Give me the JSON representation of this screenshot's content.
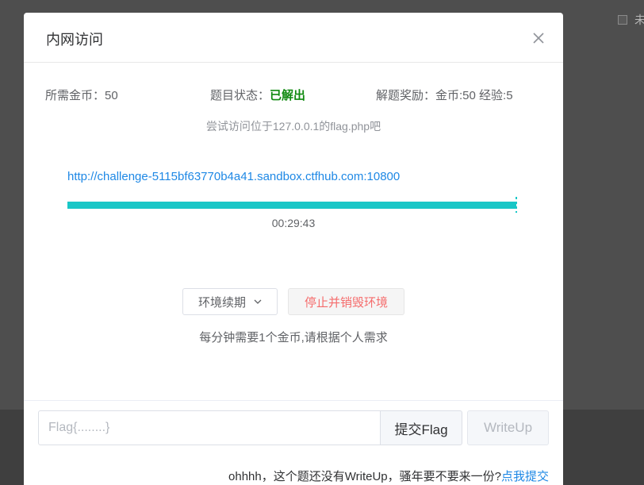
{
  "background": {
    "checkbox_text": "未"
  },
  "modal": {
    "title": "内网访问",
    "info": {
      "coins_label": "所需金币：",
      "coins_value": "50",
      "status_label": "题目状态：",
      "status_value": "已解出",
      "reward_label": "解题奖励：",
      "reward_value": "金币:50 经验:5"
    },
    "hint": "尝试访问位于127.0.0.1的flag.php吧",
    "url": "http://challenge-5115bf63770b4a41.sandbox.ctfhub.com:10800",
    "timer": "00:29:43",
    "progress_fraction": 1.0,
    "renew_label": "环境续期",
    "stop_label": "停止并销毁环境",
    "cost_note": "每分钟需要1个金币,请根据个人需求",
    "flag_placeholder": "Flag{........}",
    "submit_label": "提交Flag",
    "writeup_label": "WriteUp",
    "writeup_note": "ohhhh，这个题还没有WriteUp，骚年要不要来一份?",
    "writeup_link": "点我提交"
  },
  "colors": {
    "accent": "#19c7c7",
    "link": "#1e88e5",
    "solved": "#118a11",
    "danger": "#f56c6c"
  },
  "icons": [
    "close-icon",
    "chevron-down-icon",
    "checkbox-icon"
  ]
}
